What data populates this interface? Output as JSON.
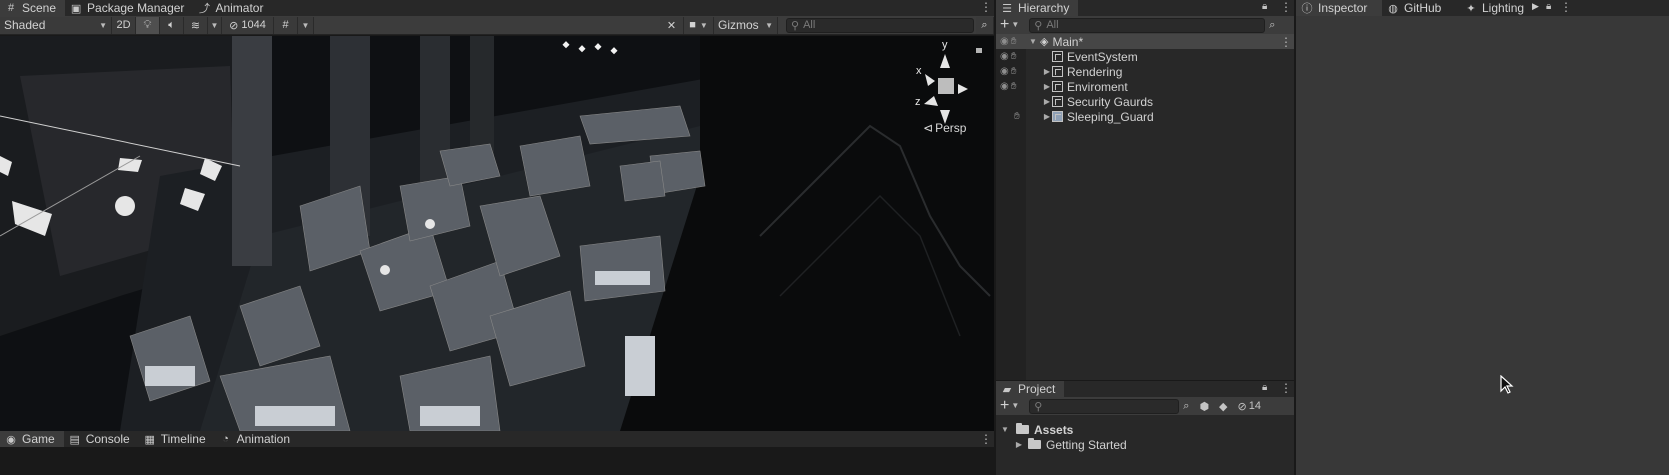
{
  "scene_window": {
    "tabs": [
      {
        "label": "Scene",
        "icon": "grid-icon",
        "active": true
      },
      {
        "label": "Package Manager",
        "icon": "package-icon",
        "active": false
      },
      {
        "label": "Animator",
        "icon": "animator-icon",
        "active": false
      }
    ],
    "toolbar": {
      "draw_mode": "Shaded",
      "mode_2d": "2D",
      "hidden_count": "1044",
      "gizmos": "Gizmos",
      "search_placeholder": "All"
    },
    "orientation_gizmo": {
      "y": "y",
      "x": "x",
      "z": "z",
      "projection": "Persp"
    }
  },
  "bottom_tabs": [
    {
      "label": "Game",
      "icon": "gamepad-icon",
      "active": true
    },
    {
      "label": "Console",
      "icon": "console-icon",
      "active": false
    },
    {
      "label": "Timeline",
      "icon": "timeline-icon",
      "active": false
    },
    {
      "label": "Animation",
      "icon": "animation-icon",
      "active": false
    }
  ],
  "hierarchy": {
    "tab_label": "Hierarchy",
    "search_placeholder": "All",
    "scene_name": "Main*",
    "items": [
      {
        "label": "EventSystem",
        "expandable": false
      },
      {
        "label": "Rendering",
        "expandable": true
      },
      {
        "label": "Enviroment",
        "expandable": true
      },
      {
        "label": "Security Gaurds",
        "expandable": true
      },
      {
        "label": "Sleeping_Guard",
        "expandable": true
      }
    ]
  },
  "project": {
    "tab_label": "Project",
    "hidden_count": "14",
    "tree": [
      {
        "label": "Assets"
      },
      {
        "label": "Getting Started"
      }
    ]
  },
  "inspector_window": {
    "tabs": [
      {
        "label": "Inspector",
        "icon": "info-icon"
      },
      {
        "label": "GitHub",
        "icon": "github-icon"
      },
      {
        "label": "Lighting",
        "icon": "bulb-icon"
      }
    ]
  },
  "colors": {
    "panel_bg": "#282828",
    "toolbar_bg": "#3c3c3c",
    "viewport_bg": "#0d0f11",
    "selected_row": "#464646"
  }
}
